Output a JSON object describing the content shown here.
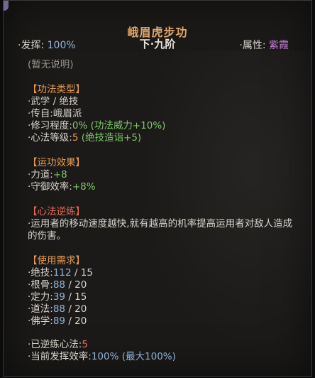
{
  "header": {
    "title": "峨眉虎步功",
    "rank_left": "下",
    "rank_sep": "·",
    "rank_right": "九阶",
    "play_label": "·发挥:",
    "play_value": "100%",
    "attr_label": "·属性:",
    "attr_value": "紫霞"
  },
  "intro": "(暂无说明)",
  "type_section": {
    "title": "【功法类型】",
    "category": "·武学 / 绝技",
    "origin_label": "·传自:",
    "origin_value": "峨眉派",
    "practice_label": "·修习程度:",
    "practice_value": "0%",
    "practice_note": "(功法威力+10%)",
    "mind_label": "·心法等级:",
    "mind_value": "5",
    "mind_note": "(绝技造诣+5)"
  },
  "effect_section": {
    "title": "【运功效果】",
    "items": [
      {
        "label": "·力道:",
        "value": "+8"
      },
      {
        "label": "·守御效率:",
        "value": "+8%"
      }
    ]
  },
  "reverse_section": {
    "title": "【心法逆练】",
    "text": "·运用者的移动速度越快,就有越高的机率提高运用者对敌人造成的伤害。"
  },
  "requirement_section": {
    "title": "【使用需求】",
    "items": [
      {
        "label": "·绝技:",
        "current": "112",
        "sep": " / ",
        "required": "15"
      },
      {
        "label": "·根骨:",
        "current": "88",
        "sep": " / ",
        "required": "20"
      },
      {
        "label": "·定力:",
        "current": "39",
        "sep": " / ",
        "required": "15"
      },
      {
        "label": "·道法:",
        "current": "88",
        "sep": " / ",
        "required": "20"
      },
      {
        "label": "·佛学:",
        "current": "89",
        "sep": " / ",
        "required": "20"
      }
    ]
  },
  "footer": {
    "reversed_label": "·已逆练心法:",
    "reversed_value": "5",
    "efficiency_label": "·当前发挥效率:",
    "efficiency_value": "100%",
    "efficiency_note": "(最大100%)"
  },
  "colors": {
    "title": "#e0a56b",
    "section": "#e69a52",
    "section_reverse": "#e46a5a",
    "value_blue": "#8fb3d8",
    "value_green": "#7ec86a",
    "value_purple": "#c47ed6",
    "value_red": "#e46a5a"
  }
}
